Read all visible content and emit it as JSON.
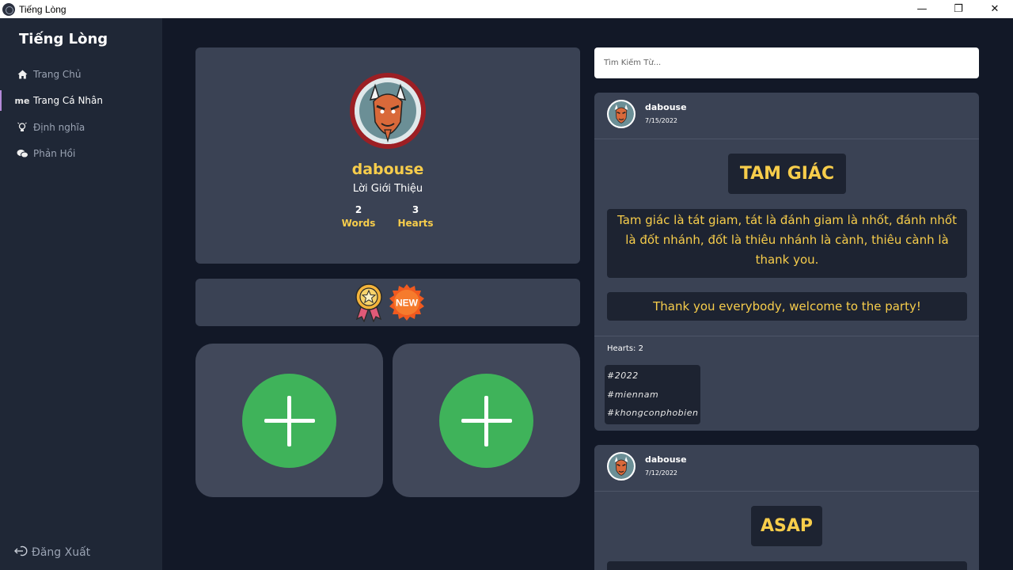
{
  "window": {
    "title": "Tiếng Lòng",
    "controls": {
      "minimize": "—",
      "restore": "❐",
      "close": "✕"
    }
  },
  "sidebar": {
    "brand": "Tiếng Lòng",
    "items": [
      {
        "label": "Trang Chủ",
        "icon": "home-icon"
      },
      {
        "label": "Trang Cá Nhân",
        "icon": "me",
        "active": true
      },
      {
        "label": "Định nghĩa",
        "icon": "lightbulb-icon"
      },
      {
        "label": "Phản Hồi",
        "icon": "chat-icon"
      }
    ],
    "logout": "Đăng Xuất"
  },
  "profile": {
    "username": "dabouse",
    "intro": "Lời Giới Thiệu",
    "stats": [
      {
        "value": "2",
        "label": "Words"
      },
      {
        "value": "3",
        "label": "Hearts"
      }
    ]
  },
  "badges": {
    "new_label": "NEW"
  },
  "search": {
    "placeholder": "Tìm Kiếm Từ..."
  },
  "posts": [
    {
      "user": "dabouse",
      "date": "7/15/2022",
      "word": "TAM GIÁC",
      "definition": "Tam giác là tát giam, tát là đánh giam là nhốt, đánh nhốt là đốt nhánh, đốt là thiêu nhánh là cành, thiêu cành là thank you.",
      "example": "Thank you everybody, welcome to the party!",
      "hearts": "Hearts: 2",
      "tags": [
        "#2022",
        "#miennam",
        "#khongconphobien"
      ]
    },
    {
      "user": "dabouse",
      "date": "7/12/2022",
      "word": "ASAP"
    }
  ],
  "colors": {
    "accent_yellow": "#f7cd4b",
    "add_green": "#3fb35a",
    "card": "#3a4254",
    "background": "#121827",
    "sidebar": "#1f2736"
  }
}
